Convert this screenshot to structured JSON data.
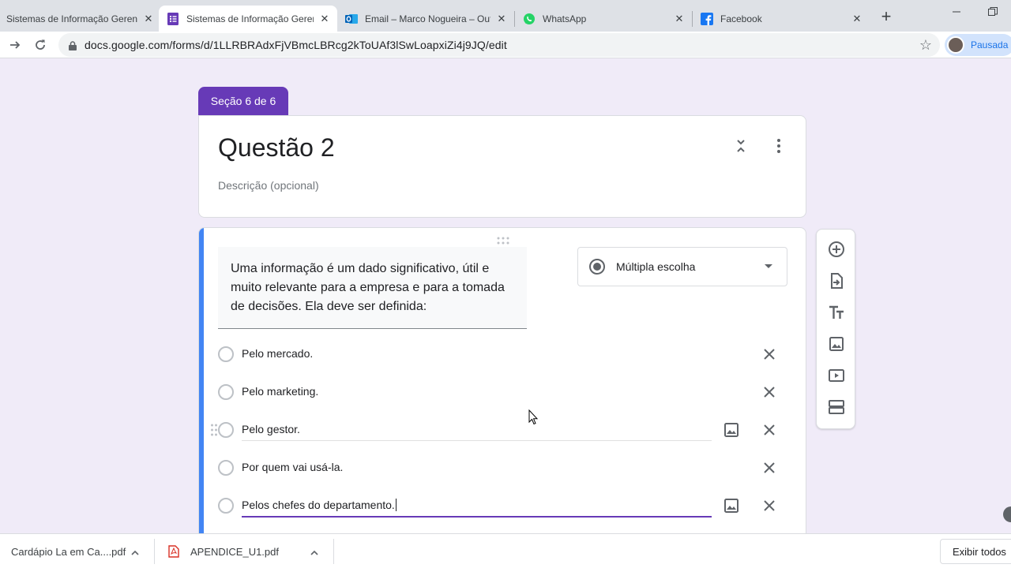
{
  "browser": {
    "tabs": [
      {
        "title": "Sistemas de Informação Gerenciais",
        "favicon": "forms-icon",
        "active": false
      },
      {
        "title": "Sistemas de Informação Gerenciais",
        "favicon": "forms-icon",
        "active": true
      },
      {
        "title": "Email – Marco Nogueira – Outlook",
        "favicon": "outlook-icon",
        "active": false
      },
      {
        "title": "WhatsApp",
        "favicon": "whatsapp-icon",
        "active": false
      },
      {
        "title": "Facebook",
        "favicon": "facebook-icon",
        "active": false
      }
    ],
    "url": "docs.google.com/forms/d/1LLRBRAdxFjVBmcLBRcg2kToUAf3lSwLoapxiZi4j9JQ/edit",
    "profile_label": "Pausada"
  },
  "form": {
    "section_tag": "Seção 6 de 6",
    "section_title": "Questão 2",
    "section_description_placeholder": "Descrição (opcional)",
    "question": {
      "title": "Uma informação é um dado significativo, útil e muito relevante para a empresa e para a tomada de decisões. Ela deve ser definida:",
      "type": "Múltipla escolha",
      "options": [
        "Pelo mercado.",
        "Pelo marketing.",
        "Pelo gestor.",
        "Por quem vai usá-la.",
        "Pelos chefes do departamento."
      ]
    }
  },
  "side_tools": [
    "add-question-icon",
    "import-questions-icon",
    "add-title-icon",
    "add-image-icon",
    "add-video-icon",
    "add-section-icon"
  ],
  "downloads": {
    "items": [
      {
        "name": "Cardápio La em Ca....pdf"
      },
      {
        "name": "APENDICE_U1.pdf"
      }
    ],
    "show_all": "Exibir todos"
  },
  "colors": {
    "accent": "#673ab7",
    "background": "#f0ebf8",
    "question_accent": "#4285f4"
  }
}
